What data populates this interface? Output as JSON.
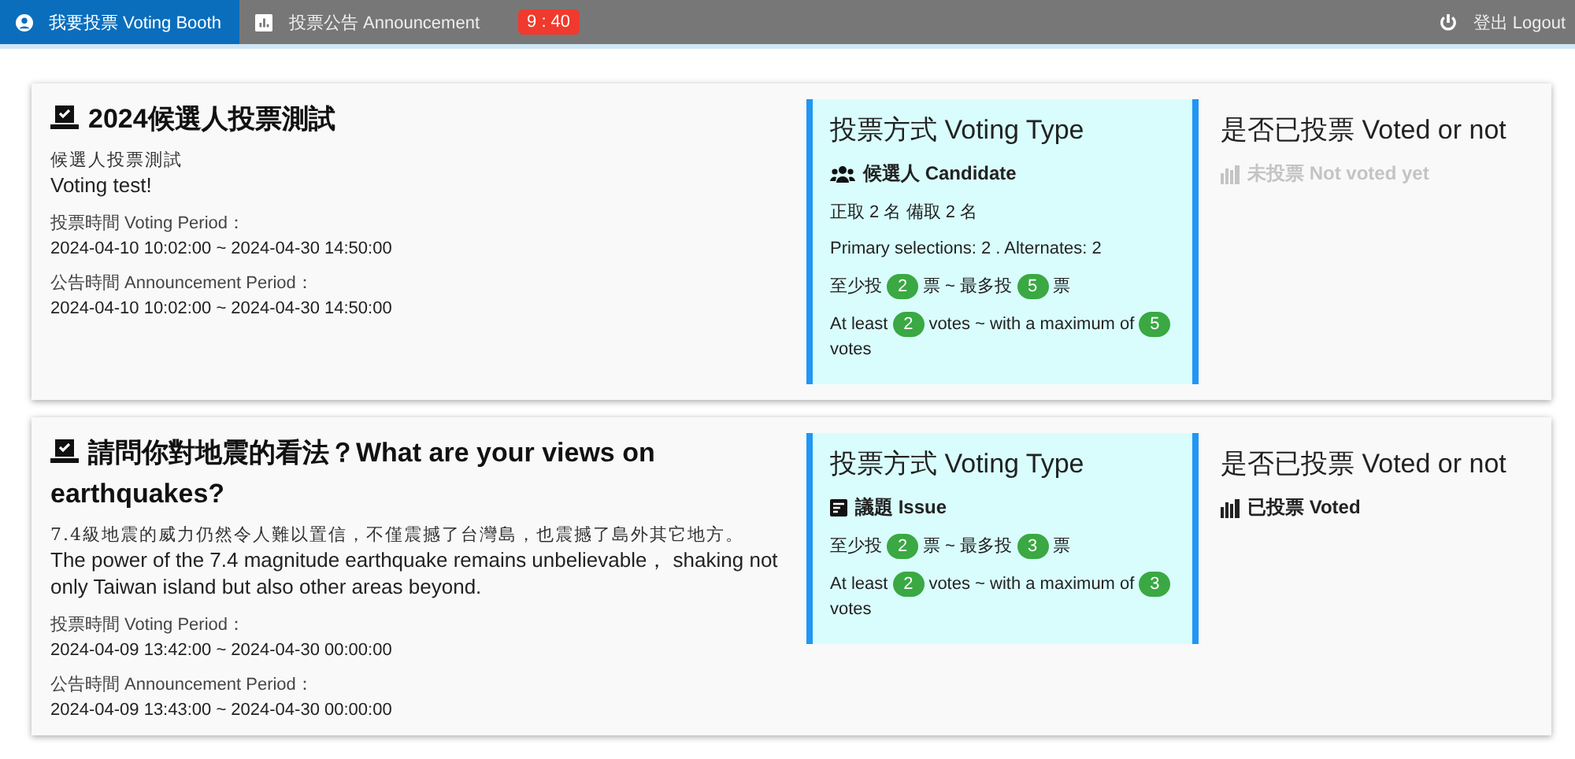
{
  "nav": {
    "tabs": [
      {
        "label": "我要投票 Voting Booth",
        "selected": true,
        "kind": "booth"
      },
      {
        "label": "投票公告 Announcement",
        "selected": false,
        "kind": "announcement"
      }
    ],
    "timer": "9 : 40",
    "logout": "登出 Logout"
  },
  "polls": [
    {
      "title": "2024候選人投票測試",
      "description_zh": "候選人投票測試",
      "description_en": "Voting test!",
      "voting_period_label": "投票時間 Voting Period：",
      "voting_period": "2024-04-10 10:02:00 ~ 2024-04-30 14:50:00",
      "announcement_period_label": "公告時間 Announcement Period：",
      "announcement_period": "2024-04-10 10:02:00 ~ 2024-04-30 14:50:00",
      "type_heading": "投票方式 Voting Type",
      "type": {
        "kind": "candidate",
        "label": "候選人 Candidate"
      },
      "info_lines": [
        "正取 2 名 備取 2 名",
        "Primary selections: 2 . Alternates: 2"
      ],
      "vote_lines": [
        [
          {
            "kind": "text",
            "text": "至少投"
          },
          {
            "kind": "badge",
            "text": "2"
          },
          {
            "kind": "text",
            "text": "票 ~ 最多投"
          },
          {
            "kind": "badge",
            "text": "5"
          },
          {
            "kind": "text",
            "text": "票"
          }
        ],
        [
          {
            "kind": "text",
            "text": "At least"
          },
          {
            "kind": "badge",
            "text": "2"
          },
          {
            "kind": "text",
            "text": "votes ~ with a maximum of"
          },
          {
            "kind": "badge",
            "text": "5"
          },
          {
            "kind": "text",
            "text": "votes"
          }
        ]
      ],
      "voted_heading": "是否已投票 Voted or not",
      "voted": false,
      "voted_label": "未投票 Not voted yet"
    },
    {
      "title": "請問你對地震的看法？What are your views on earthquakes?",
      "description_zh": "7.4級地震的威力仍然令人難以置信，不僅震撼了台灣島，也震撼了島外其它地方。",
      "description_en": "The power of the 7.4 magnitude earthquake remains unbelievable， shaking not only Taiwan island but also other areas beyond.",
      "voting_period_label": "投票時間 Voting Period：",
      "voting_period": "2024-04-09 13:42:00 ~ 2024-04-30 00:00:00",
      "announcement_period_label": "公告時間 Announcement Period：",
      "announcement_period": "2024-04-09 13:43:00 ~ 2024-04-30 00:00:00",
      "type_heading": "投票方式 Voting Type",
      "type": {
        "kind": "issue",
        "label": "議題 Issue"
      },
      "vote_lines": [
        [
          {
            "kind": "text",
            "text": "至少投"
          },
          {
            "kind": "badge",
            "text": "2"
          },
          {
            "kind": "text",
            "text": "票 ~ 最多投"
          },
          {
            "kind": "badge",
            "text": "3"
          },
          {
            "kind": "text",
            "text": "票"
          }
        ],
        [
          {
            "kind": "text",
            "text": "At least"
          },
          {
            "kind": "badge",
            "text": "2"
          },
          {
            "kind": "text",
            "text": "votes ~ with a maximum of"
          },
          {
            "kind": "badge",
            "text": "3"
          },
          {
            "kind": "text",
            "text": "votes"
          }
        ]
      ],
      "voted_heading": "是否已投票 Voted or not",
      "voted": true,
      "voted_label": "已投票 Voted"
    }
  ]
}
